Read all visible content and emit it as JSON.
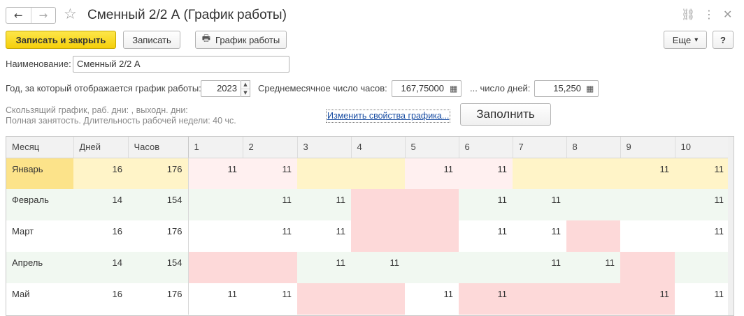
{
  "window": {
    "title": "Сменный 2/2 А (График работы)",
    "back_icon": "←",
    "forward_icon": "→",
    "favorite_icon": "☆",
    "link_icon": "⛓",
    "menu_icon": "⋮",
    "close_icon": "✕"
  },
  "toolbar": {
    "save_close": "Записать и закрыть",
    "save": "Записать",
    "schedule_icon": "🖶",
    "schedule": "График работы",
    "more": "Еще",
    "more_arrow": "▾",
    "help": "?"
  },
  "form": {
    "name_label": "Наименование:",
    "name_value": "Сменный 2/2 А",
    "year_label": "Год, за который отображается график работы:",
    "year_value": "2023",
    "avg_hours_label": "Среднемесячное число часов:",
    "avg_hours_value": "167,75000",
    "days_label": "... число дней:",
    "days_value": "15,250",
    "calc_icon": "▦",
    "spin_up": "▲",
    "spin_down": "▼"
  },
  "info": {
    "line1": "Скользящий график, раб. дни: , выходн. дни:",
    "line2": "Полная занятость. Длительность рабочей недели: 40 чс.",
    "change_link": "Изменить свойства графика...",
    "fill_button": "Заполнить"
  },
  "grid": {
    "headers": [
      "Месяц",
      "Дней",
      "Часов",
      "1",
      "2",
      "3",
      "4",
      "5",
      "6",
      "7",
      "8",
      "9",
      "10"
    ],
    "rows": [
      {
        "month": "Январь",
        "days": "16",
        "hours": "176",
        "cells": [
          "11",
          "11",
          "",
          "",
          "11",
          "11",
          "",
          "",
          "11",
          "11"
        ]
      },
      {
        "month": "Февраль",
        "days": "14",
        "hours": "154",
        "cells": [
          "",
          "11",
          "11",
          "",
          "",
          "11",
          "11",
          "",
          "",
          "11"
        ]
      },
      {
        "month": "Март",
        "days": "16",
        "hours": "176",
        "cells": [
          "",
          "11",
          "11",
          "",
          "",
          "11",
          "11",
          "",
          "",
          "11"
        ]
      },
      {
        "month": "Апрель",
        "days": "14",
        "hours": "154",
        "cells": [
          "",
          "",
          "11",
          "11",
          "",
          "",
          "11",
          "11",
          "",
          ""
        ]
      },
      {
        "month": "Май",
        "days": "16",
        "hours": "176",
        "cells": [
          "11",
          "11",
          "",
          "",
          "11",
          "11",
          "",
          "",
          "11",
          "11"
        ]
      }
    ]
  },
  "colors": {
    "primary": "#f5cf0a",
    "weekend": "#fdd9d9",
    "weekend_selected": "#fff0f0",
    "selected_row": "#fff4c8",
    "selected_cell": "#fce38a",
    "alt_row": "#f1f8f1"
  }
}
